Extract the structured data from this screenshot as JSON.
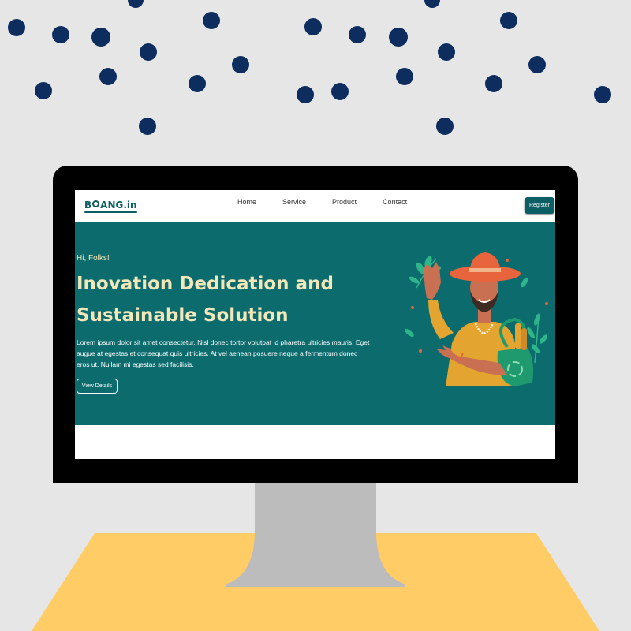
{
  "site": {
    "logo": {
      "prefix": "B",
      "suffix": "ANG.in"
    },
    "nav": [
      "Home",
      "Service",
      "Product",
      "Contact"
    ],
    "register_label": "Register"
  },
  "hero": {
    "greeting": "Hi, Folks!",
    "headline_line1": "Inovation Dedication and",
    "headline_line2": "Sustainable Solution",
    "paragraph": "Lorem ipsum dolor sit amet consectetur. Nisl donec tortor volutpat id pharetra ultricies mauris. Eget augue at egestas et consequat quis ultricies. At vel aenean posuere neque a fermentum donec eros ut. Nullam mi egestas sed facilisis.",
    "button_label": "View Details"
  },
  "colors": {
    "background": "#e6e6e6",
    "dots": "#0d2d5e",
    "brand": "#0b5e63",
    "hero_bg": "#0b6b6d",
    "heading": "#f3e7b9",
    "desk": "#ffcc66",
    "stand": "#bcbcbc"
  },
  "icons": [
    "recycle-icon",
    "leaf-icon",
    "sun-hat-icon"
  ]
}
